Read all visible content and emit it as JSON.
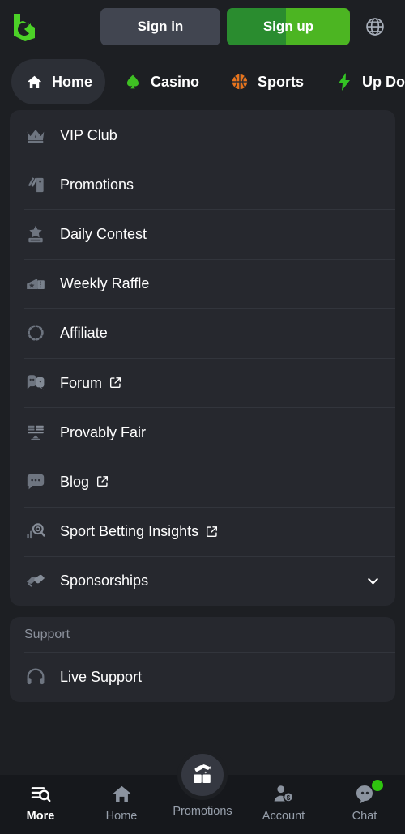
{
  "brand": {
    "logo_name": "b-logo",
    "accent_green": "#4cb522",
    "accent_green_dark": "#2a8c2f"
  },
  "topbar": {
    "signin_label": "Sign in",
    "signup_label": "Sign up",
    "language_icon": "globe-icon"
  },
  "tabs": [
    {
      "label": "Home",
      "icon": "home-icon",
      "active": true
    },
    {
      "label": "Casino",
      "icon": "spade-icon",
      "active": false
    },
    {
      "label": "Sports",
      "icon": "basketball-icon",
      "active": false
    },
    {
      "label": "Up Down",
      "icon": "lightning-bolt-icon",
      "active": false
    },
    {
      "label": "",
      "icon": "pulse-icon",
      "active": false
    }
  ],
  "menu": {
    "items": [
      {
        "label": "VIP Club",
        "icon": "crown-icon",
        "external": false,
        "expandable": false
      },
      {
        "label": "Promotions",
        "icon": "tags-icon",
        "external": false,
        "expandable": false
      },
      {
        "label": "Daily Contest",
        "icon": "trophy-star-icon",
        "external": false,
        "expandable": false
      },
      {
        "label": "Weekly Raffle",
        "icon": "ticket-icon",
        "external": false,
        "expandable": false
      },
      {
        "label": "Affiliate",
        "icon": "dotted-circle-icon",
        "external": false,
        "expandable": false
      },
      {
        "label": "Forum",
        "icon": "speech-faces-icon",
        "external": true,
        "expandable": false
      },
      {
        "label": "Provably Fair",
        "icon": "balance-scale-icon",
        "external": false,
        "expandable": false
      },
      {
        "label": "Blog",
        "icon": "chat-bubble-icon",
        "external": true,
        "expandable": false
      },
      {
        "label": "Sport Betting Insights",
        "icon": "chart-magnifier-icon",
        "external": true,
        "expandable": false
      },
      {
        "label": "Sponsorships",
        "icon": "handshake-icon",
        "external": false,
        "expandable": true
      }
    ]
  },
  "support": {
    "header": "Support",
    "items": [
      {
        "label": "Live Support",
        "icon": "headset-icon"
      }
    ]
  },
  "bottomnav": [
    {
      "label": "More",
      "icon": "list-search-icon",
      "active": true,
      "badge": false,
      "fab": false
    },
    {
      "label": "Home",
      "icon": "home-icon",
      "active": false,
      "badge": false,
      "fab": false
    },
    {
      "label": "Promotions",
      "icon": "gift-icon",
      "active": false,
      "badge": false,
      "fab": true
    },
    {
      "label": "Account",
      "icon": "user-coin-icon",
      "active": false,
      "badge": false,
      "fab": false
    },
    {
      "label": "Chat",
      "icon": "chat-face-icon",
      "active": false,
      "badge": true,
      "fab": false
    }
  ]
}
